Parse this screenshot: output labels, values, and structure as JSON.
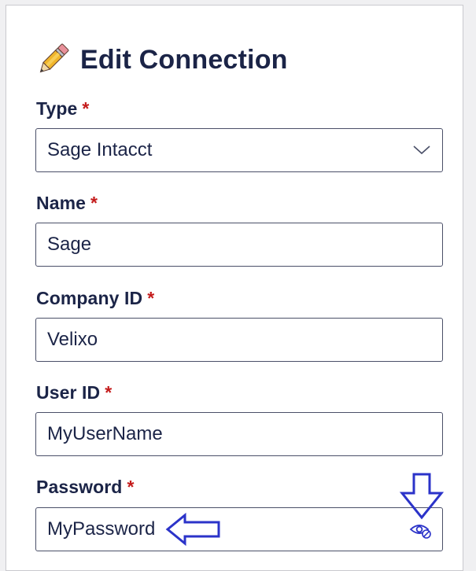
{
  "header": {
    "title": "Edit Connection",
    "icon": "pencil-icon"
  },
  "form": {
    "required_marker": "*",
    "type": {
      "label": "Type",
      "value": "Sage Intacct"
    },
    "name": {
      "label": "Name",
      "value": "Sage"
    },
    "company_id": {
      "label": "Company ID",
      "value": "Velixo"
    },
    "user_id": {
      "label": "User ID",
      "value": "MyUserName"
    },
    "password": {
      "label": "Password",
      "value": "MyPassword",
      "toggle_icon": "eye-slash-icon"
    }
  },
  "colors": {
    "text": "#1b2447",
    "required": "#c41b1b",
    "border": "#4a4f68",
    "annotation": "#2b33c9",
    "pencil": "#f0b52b"
  }
}
